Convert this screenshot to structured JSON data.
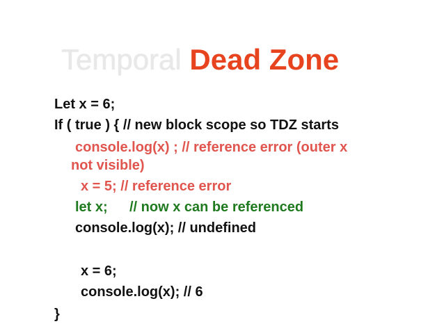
{
  "slide": {
    "title": {
      "part1": "Temporal",
      "part2": "Dead Zone"
    },
    "code": {
      "line1": "Let x = 6;",
      "line2": "If ( true ) { // new block scope so TDZ starts",
      "line3a": "console.log(x) ; // reference error (outer x",
      "line3b": "not visible)",
      "line4": "x = 5;  // reference error",
      "line5a": "let x;",
      "line5b": "// now x can be referenced",
      "line6": "console.log(x); // undefined",
      "line7": "x = 6;",
      "line8": "console.log(x); // 6",
      "line9": "}"
    }
  },
  "colors": {
    "title_light": "#e8e8e8",
    "title_accent": "#e7431f",
    "code_black": "#111111",
    "code_red": "#e0554d",
    "code_green": "#1f7a1f"
  }
}
